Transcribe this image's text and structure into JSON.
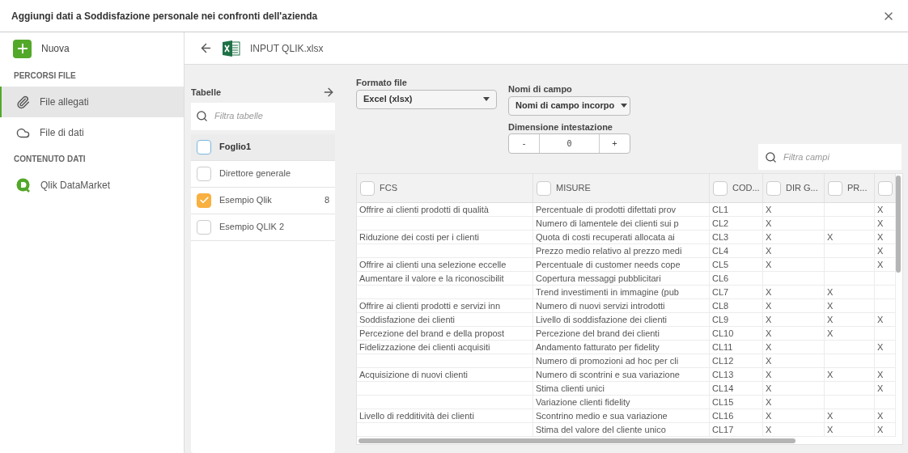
{
  "dialog": {
    "title": "Aggiungi dati a Soddisfazione personale nei confronti dell'azienda"
  },
  "sidebar": {
    "new_button": "Nuova",
    "sections": [
      {
        "heading": "PERCORSI FILE",
        "items": [
          {
            "label": "File allegati",
            "selected": true
          },
          {
            "label": "File di dati",
            "selected": false
          }
        ]
      },
      {
        "heading": "CONTENUTO DATI",
        "items": [
          {
            "label": "Qlik DataMarket",
            "selected": false
          }
        ]
      }
    ]
  },
  "file_header": {
    "file_name": "INPUT QLIK.xlsx"
  },
  "tables_panel": {
    "title": "Tabelle",
    "search": {
      "placeholder": "Filtra tabelle"
    },
    "items": [
      {
        "label": "Foglio1",
        "checked": false,
        "selected": true
      },
      {
        "label": "Direttore generale",
        "checked": false,
        "selected": false
      },
      {
        "label": "Esempio Qlik",
        "checked": true,
        "selected": false,
        "count": "8"
      },
      {
        "label": "Esempio QLIK 2",
        "checked": false,
        "selected": false
      }
    ]
  },
  "options": {
    "file_format": {
      "label": "Formato file",
      "value": "Excel (xlsx)"
    },
    "field_names": {
      "label": "Nomi di campo",
      "value": "Nomi di campo incorpo"
    },
    "header_size": {
      "label": "Dimensione intestazione",
      "decrement": "-",
      "value": "0",
      "increment": "+"
    }
  },
  "field_search": {
    "placeholder": "Filtra campi"
  },
  "table": {
    "columns": [
      {
        "label": "FCS",
        "checked": false
      },
      {
        "label": "MISURE",
        "checked": false
      },
      {
        "label": "COD...",
        "checked": false
      },
      {
        "label": "DIR G...",
        "checked": false
      },
      {
        "label": "PR...",
        "checked": false
      },
      {
        "checked": false
      }
    ],
    "rows": [
      [
        "Offrire ai clienti prodotti di qualità",
        "Percentuale di prodotti difettati prov",
        "CL1",
        "X",
        null,
        "X"
      ],
      [
        null,
        "Numero di lamentele dei clienti sui p",
        "CL2",
        "X",
        null,
        "X"
      ],
      [
        "Riduzione dei costi per i clienti",
        "Quota di costi recuperati allocata ai",
        "CL3",
        "X",
        "X",
        "X"
      ],
      [
        null,
        "Prezzo medio relativo al prezzo medi",
        "CL4",
        "X",
        null,
        "X"
      ],
      [
        "Offrire ai clienti una selezione eccelle",
        "Percentuale di customer needs cope",
        "CL5",
        "X",
        null,
        "X"
      ],
      [
        "Aumentare il valore e la riconoscibilit",
        "Copertura messaggi pubblicitari",
        "CL6",
        null,
        null,
        null
      ],
      [
        null,
        "Trend investimenti in immagine (pub",
        "CL7",
        "X",
        "X",
        null
      ],
      [
        "Offrire ai clienti prodotti e servizi inn",
        "Numero di nuovi servizi introdotti",
        "CL8",
        "X",
        "X",
        null
      ],
      [
        "Soddisfazione dei clienti",
        "Livello di soddisfazione dei clienti",
        "CL9",
        "X",
        "X",
        "X"
      ],
      [
        "Percezione del brand e della propost",
        "Percezione del brand dei clienti",
        "CL10",
        "X",
        "X",
        null
      ],
      [
        "Fidelizzazione dei clienti acquisiti",
        "Andamento fatturato per fidelity",
        "CL11",
        "X",
        null,
        "X"
      ],
      [
        null,
        "Numero di promozioni ad hoc per cli",
        "CL12",
        "X",
        null,
        null
      ],
      [
        "Acquisizione di nuovi clienti",
        "Numero di scontrini e sua variazione",
        "CL13",
        "X",
        "X",
        "X"
      ],
      [
        null,
        "Stima clienti unici",
        "CL14",
        "X",
        null,
        "X"
      ],
      [
        null,
        "Variazione clienti fidelity",
        "CL15",
        "X",
        null,
        null
      ],
      [
        "Livello di redditività dei clienti",
        "Scontrino medio e sua variazione",
        "CL16",
        "X",
        "X",
        "X"
      ],
      [
        null,
        "Stima del valore del cliente unico",
        "CL17",
        "X",
        "X",
        "X"
      ]
    ]
  }
}
